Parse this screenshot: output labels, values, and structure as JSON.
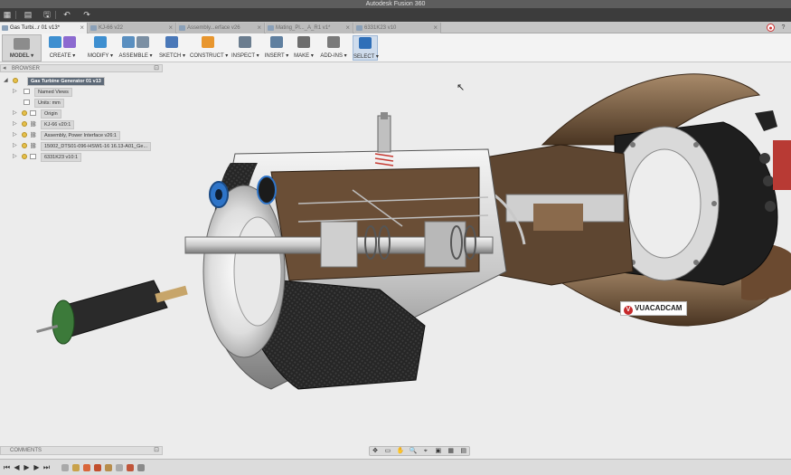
{
  "app": {
    "title": "Autodesk Fusion 360"
  },
  "quick_access": [
    {
      "name": "grid-icon",
      "glyph": "▦"
    },
    {
      "name": "file-menu-icon",
      "glyph": "▤"
    },
    {
      "name": "save-icon",
      "glyph": "🖫"
    },
    {
      "name": "undo-icon",
      "glyph": "↶"
    },
    {
      "name": "redo-icon",
      "glyph": "↷"
    }
  ],
  "tabs": [
    {
      "label": "Gas Turbi...r 01 v13*",
      "active": true
    },
    {
      "label": "KJ-66 v22",
      "active": false
    },
    {
      "label": "Assembly...erface v26",
      "active": false
    },
    {
      "label": "Mating_Pl..._A_R1 v1*",
      "active": false
    },
    {
      "label": "6331K23 v10",
      "active": false
    }
  ],
  "tab_close_glyph": "×",
  "toolbar": {
    "workspace": "MODEL ▾",
    "groups": [
      {
        "label": "CREATE ▾",
        "icons": [
          "#3e8fd0",
          "#8c6ad0"
        ]
      },
      {
        "label": "MODIFY ▾",
        "icons": [
          "#3e8fd0"
        ]
      },
      {
        "label": "ASSEMBLE ▾",
        "icons": [
          "#5a8fc0",
          "#7b8fa3"
        ]
      },
      {
        "label": "SKETCH ▾",
        "icons": [
          "#4a78b8"
        ]
      },
      {
        "label": "CONSTRUCT ▾",
        "icons": [
          "#e8962e"
        ]
      },
      {
        "label": "INSPECT ▾",
        "icons": [
          "#6b7d8f"
        ]
      },
      {
        "label": "INSERT ▾",
        "icons": [
          "#5f7f9f"
        ]
      },
      {
        "label": "MAKE ▾",
        "icons": [
          "#6d6d6d"
        ]
      },
      {
        "label": "ADD-INS ▾",
        "icons": [
          "#7a7a7a"
        ]
      },
      {
        "label": "SELECT ▾",
        "icons": [
          "#2f6fb8"
        ]
      }
    ]
  },
  "browser": {
    "header": "BROWSER",
    "collapse_glyph": "◂",
    "pin_glyph": "⊡",
    "root": "Gas Turbine Generator 01 v13",
    "items": [
      {
        "label": "Named Views",
        "expander": "▷",
        "kind": "folder"
      },
      {
        "label": "Units: mm",
        "expander": "",
        "kind": "doc"
      },
      {
        "label": "Origin",
        "expander": "▷",
        "kind": "folder"
      },
      {
        "label": "KJ-66 v20:1",
        "expander": "▷",
        "kind": "link"
      },
      {
        "label": "Assembly, Power Interface v26:1",
        "expander": "▷",
        "kind": "link"
      },
      {
        "label": "15002_DTS01-096-HSW1-16 16.13-A01_Ge...",
        "expander": "▷",
        "kind": "link"
      },
      {
        "label": "6331K23 v10:1",
        "expander": "▷",
        "kind": "link"
      }
    ],
    "root_expander": "◢",
    "link_glyph": "⛓"
  },
  "viewport": {
    "watermark": "VUACADCAM",
    "watermark_logo": "V",
    "cursor_glyph": "↖"
  },
  "comments": {
    "header": "COMMENTS",
    "pin_glyph": "⊡"
  },
  "navbar": [
    "✥",
    "▭",
    "✋",
    "🔍",
    "⌖",
    "▣",
    "▦",
    "▤"
  ],
  "timeline": {
    "controls": [
      "⏮",
      "◀",
      "▶",
      "▶",
      "⏭"
    ],
    "features": [
      "#a9a9a9",
      "#c9a24b",
      "#d9663a",
      "#c24f2e",
      "#b78d4c",
      "#aaaaaa",
      "#c0553a",
      "#8a8a8a"
    ]
  }
}
